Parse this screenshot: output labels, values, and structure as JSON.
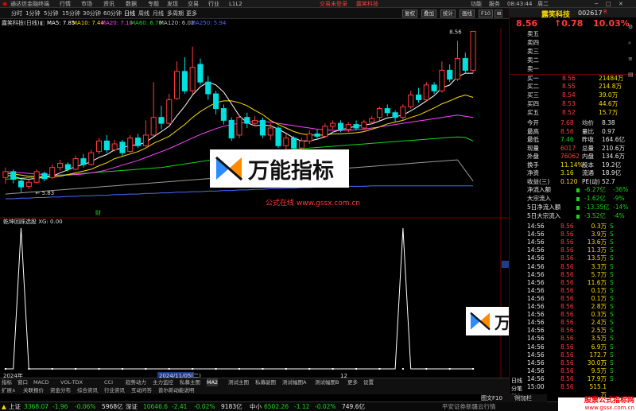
{
  "menu": {
    "app": "通达信金融终端",
    "items": [
      "行情",
      "市场",
      "资讯",
      "数据",
      "专题",
      "发现",
      "交易",
      "行业",
      "L1L2"
    ],
    "center_login": "交易未登录",
    "center_stock": "露笑科技",
    "right": [
      "功能",
      "服务",
      "08:43:44",
      "周二"
    ]
  },
  "timeframes": [
    "分时",
    "1分钟",
    "5分钟",
    "15分钟",
    "30分钟",
    "60分钟",
    "日线",
    "周线",
    "月线",
    "多周期",
    "更多"
  ],
  "toolbar_buttons": [
    "复权",
    "叠加",
    "统计",
    "画线",
    "F10"
  ],
  "title_bar": {
    "name": "露笑科技(日线)",
    "indicators": [
      {
        "label": "MA5: 7.85",
        "color": "#ffffff"
      },
      {
        "label": "MA10: 7.44",
        "color": "#ffdd00"
      },
      {
        "label": "MA20: 7.10",
        "color": "#ff44ff"
      },
      {
        "label": "MA60: 6.70",
        "color": "#19d619"
      },
      {
        "label": "MA120: 6.02",
        "color": "#c0c0c0"
      },
      {
        "label": "MA250: 5.94",
        "color": "#4a6cff"
      }
    ]
  },
  "chart_data": {
    "type": "candlestick",
    "y_ticks": [
      "8.50",
      "8.25",
      "8.00",
      "7.75",
      "7.50",
      "7.25",
      "7.00",
      "6.75",
      "6.50",
      "6.25",
      "6.00",
      "5.75"
    ],
    "high_label": "8.56",
    "low_label": "5.83",
    "candles": [
      {
        "o": 6.08,
        "c": 6.18,
        "h": 6.25,
        "l": 5.97
      },
      {
        "o": 6.18,
        "c": 6.05,
        "h": 6.22,
        "l": 5.98
      },
      {
        "o": 6.02,
        "c": 5.92,
        "h": 6.06,
        "l": 5.83
      },
      {
        "o": 5.93,
        "c": 6.0,
        "h": 6.05,
        "l": 5.88
      },
      {
        "o": 6.0,
        "c": 6.18,
        "h": 6.22,
        "l": 5.97
      },
      {
        "o": 6.15,
        "c": 6.06,
        "h": 6.18,
        "l": 6.02
      },
      {
        "o": 6.08,
        "c": 6.25,
        "h": 6.3,
        "l": 6.05
      },
      {
        "o": 6.25,
        "c": 6.32,
        "h": 6.38,
        "l": 6.2
      },
      {
        "o": 6.3,
        "c": 6.22,
        "h": 6.34,
        "l": 6.18
      },
      {
        "o": 6.22,
        "c": 6.4,
        "h": 6.45,
        "l": 6.2
      },
      {
        "o": 6.4,
        "c": 6.3,
        "h": 6.48,
        "l": 6.25
      },
      {
        "o": 6.3,
        "c": 6.5,
        "h": 6.55,
        "l": 6.28
      },
      {
        "o": 6.52,
        "c": 6.7,
        "h": 6.75,
        "l": 6.48
      },
      {
        "o": 6.7,
        "c": 6.55,
        "h": 6.8,
        "l": 6.5
      },
      {
        "o": 6.55,
        "c": 6.65,
        "h": 6.72,
        "l": 6.52
      },
      {
        "o": 6.68,
        "c": 6.5,
        "h": 6.72,
        "l": 6.45
      },
      {
        "o": 6.52,
        "c": 6.75,
        "h": 6.8,
        "l": 6.5
      },
      {
        "o": 6.75,
        "c": 6.62,
        "h": 6.82,
        "l": 6.58
      },
      {
        "o": 6.62,
        "c": 6.8,
        "h": 7.05,
        "l": 6.6
      },
      {
        "o": 6.8,
        "c": 7.1,
        "h": 7.7,
        "l": 6.78
      },
      {
        "o": 7.1,
        "c": 7.0,
        "h": 7.3,
        "l": 6.9
      },
      {
        "o": 7.0,
        "c": 7.4,
        "h": 7.5,
        "l": 6.98
      },
      {
        "o": 7.42,
        "c": 7.88,
        "h": 8.05,
        "l": 7.4
      },
      {
        "o": 7.88,
        "c": 7.55,
        "h": 8.12,
        "l": 7.5
      },
      {
        "o": 7.55,
        "c": 7.95,
        "h": 8.3,
        "l": 7.5
      },
      {
        "o": 8.0,
        "c": 7.7,
        "h": 8.1,
        "l": 7.65
      },
      {
        "o": 7.7,
        "c": 7.5,
        "h": 7.8,
        "l": 7.4
      },
      {
        "o": 7.5,
        "c": 7.25,
        "h": 7.55,
        "l": 7.15
      },
      {
        "o": 7.25,
        "c": 7.05,
        "h": 7.32,
        "l": 6.98
      },
      {
        "o": 7.05,
        "c": 6.75,
        "h": 7.1,
        "l": 6.7
      },
      {
        "o": 6.8,
        "c": 7.1,
        "h": 7.15,
        "l": 6.75
      },
      {
        "o": 7.1,
        "c": 7.0,
        "h": 7.18,
        "l": 6.92
      },
      {
        "o": 7.0,
        "c": 7.05,
        "h": 7.12,
        "l": 6.95
      },
      {
        "o": 7.05,
        "c": 6.8,
        "h": 7.1,
        "l": 6.75
      },
      {
        "o": 6.8,
        "c": 6.92,
        "h": 7.0,
        "l": 6.72
      },
      {
        "o": 6.92,
        "c": 6.62,
        "h": 6.95,
        "l": 6.58
      },
      {
        "o": 6.62,
        "c": 6.75,
        "h": 6.82,
        "l": 6.55
      },
      {
        "o": 6.75,
        "c": 6.58,
        "h": 6.78,
        "l": 6.5
      },
      {
        "o": 6.58,
        "c": 6.7,
        "h": 6.75,
        "l": 6.52
      },
      {
        "o": 6.7,
        "c": 6.82,
        "h": 6.88,
        "l": 6.65
      },
      {
        "o": 6.82,
        "c": 6.78,
        "h": 6.9,
        "l": 6.72
      },
      {
        "o": 6.78,
        "c": 6.95,
        "h": 7.0,
        "l": 6.75
      },
      {
        "o": 6.95,
        "c": 7.0,
        "h": 7.05,
        "l": 6.9
      },
      {
        "o": 7.0,
        "c": 6.9,
        "h": 7.05,
        "l": 6.85
      },
      {
        "o": 6.9,
        "c": 6.98,
        "h": 7.02,
        "l": 6.85
      },
      {
        "o": 6.98,
        "c": 6.92,
        "h": 7.05,
        "l": 6.88
      },
      {
        "o": 6.92,
        "c": 7.02,
        "h": 7.06,
        "l": 6.88
      },
      {
        "o": 7.02,
        "c": 7.08,
        "h": 7.12,
        "l": 6.98
      },
      {
        "o": 7.1,
        "c": 7.25,
        "h": 7.28,
        "l": 7.05
      },
      {
        "o": 7.25,
        "c": 7.18,
        "h": 7.32,
        "l": 7.12
      },
      {
        "o": 7.18,
        "c": 7.1,
        "h": 7.22,
        "l": 7.02
      },
      {
        "o": 7.1,
        "c": 7.28,
        "h": 7.32,
        "l": 7.05
      },
      {
        "o": 7.28,
        "c": 7.48,
        "h": 7.55,
        "l": 7.25
      },
      {
        "o": 7.48,
        "c": 7.4,
        "h": 7.6,
        "l": 7.35
      },
      {
        "o": 7.4,
        "c": 7.65,
        "h": 7.7,
        "l": 7.38
      },
      {
        "o": 7.65,
        "c": 7.55,
        "h": 7.7,
        "l": 7.5
      },
      {
        "o": 7.55,
        "c": 7.9,
        "h": 8.05,
        "l": 7.52
      },
      {
        "o": 7.9,
        "c": 7.75,
        "h": 8.0,
        "l": 7.7
      },
      {
        "o": 7.75,
        "c": 8.1,
        "h": 8.4,
        "l": 7.72
      },
      {
        "o": 8.1,
        "c": 7.9,
        "h": 8.2,
        "l": 7.85
      },
      {
        "o": 7.9,
        "c": 8.56,
        "h": 8.56,
        "l": 7.85
      }
    ],
    "ma5": [
      6.12,
      6.1,
      6.06,
      6.05,
      6.07,
      6.08,
      6.1,
      6.16,
      6.21,
      6.27,
      6.3,
      6.35,
      6.42,
      6.47,
      6.55,
      6.58,
      6.63,
      6.63,
      6.68,
      6.77,
      6.86,
      6.95,
      7.13,
      7.29,
      7.48,
      7.62,
      7.7,
      7.65,
      7.53,
      7.33,
      7.13,
      7.01,
      6.96,
      6.97,
      6.96,
      6.9,
      6.83,
      6.75,
      6.7,
      6.7,
      6.73,
      6.77,
      6.85,
      6.89,
      6.92,
      6.95,
      6.97,
      6.99,
      7.04,
      7.09,
      7.11,
      7.14,
      7.21,
      7.29,
      7.38,
      7.47,
      7.6,
      7.65,
      7.79,
      7.85,
      7.85
    ],
    "ma10": [
      6.15,
      6.14,
      6.12,
      6.1,
      6.1,
      6.09,
      6.09,
      6.1,
      6.13,
      6.16,
      6.19,
      6.22,
      6.28,
      6.33,
      6.4,
      6.44,
      6.48,
      6.52,
      6.58,
      6.66,
      6.72,
      6.78,
      6.88,
      6.98,
      7.1,
      7.2,
      7.28,
      7.35,
      7.38,
      7.38,
      7.35,
      7.3,
      7.22,
      7.15,
      7.05,
      6.98,
      6.92,
      6.86,
      6.82,
      6.8,
      6.8,
      6.8,
      6.82,
      6.82,
      6.83,
      6.84,
      6.86,
      6.9,
      6.94,
      6.99,
      7.02,
      7.05,
      7.1,
      7.14,
      7.2,
      7.26,
      7.33,
      7.38,
      7.44,
      7.48,
      7.44
    ],
    "ma20": [
      6.18,
      6.17,
      6.16,
      6.15,
      6.14,
      6.13,
      6.12,
      6.12,
      6.12,
      6.13,
      6.14,
      6.16,
      6.18,
      6.21,
      6.25,
      6.29,
      6.33,
      6.37,
      6.42,
      6.47,
      6.52,
      6.57,
      6.63,
      6.69,
      6.75,
      6.81,
      6.86,
      6.91,
      6.95,
      6.98,
      7.0,
      7.02,
      7.03,
      7.03,
      7.02,
      7.0,
      6.98,
      6.96,
      6.94,
      6.92,
      6.9,
      6.89,
      6.88,
      6.88,
      6.88,
      6.89,
      6.9,
      6.92,
      6.94,
      6.96,
      6.98,
      7.0,
      7.02,
      7.04,
      7.06,
      7.08,
      7.1,
      7.12,
      7.14,
      7.12,
      7.1
    ],
    "ma60": [
      6.05,
      6.06,
      6.07,
      6.08,
      6.09,
      6.1,
      6.11,
      6.12,
      6.13,
      6.14,
      6.15,
      6.16,
      6.17,
      6.18,
      6.19,
      6.2,
      6.21,
      6.22,
      6.23,
      6.24,
      6.25,
      6.27,
      6.29,
      6.31,
      6.33,
      6.35,
      6.37,
      6.39,
      6.41,
      6.43,
      6.45,
      6.47,
      6.49,
      6.51,
      6.53,
      6.54,
      6.55,
      6.56,
      6.57,
      6.58,
      6.59,
      6.6,
      6.61,
      6.62,
      6.63,
      6.64,
      6.65,
      6.66,
      6.67,
      6.68,
      6.69,
      6.7,
      6.71,
      6.72,
      6.73,
      6.74,
      6.75,
      6.76,
      6.77,
      6.76,
      6.7
    ],
    "ma120": [
      5.8,
      5.81,
      5.82,
      5.83,
      5.84,
      5.85,
      5.86,
      5.87,
      5.88,
      5.89,
      5.9,
      5.91,
      5.92,
      5.93,
      5.94,
      5.95,
      5.96,
      5.97,
      5.98,
      5.99,
      6.0,
      6.01,
      6.02,
      6.03,
      6.04,
      6.05,
      6.06,
      6.07,
      6.08,
      6.09,
      6.1,
      6.11,
      6.12,
      6.13,
      6.14,
      6.15,
      6.16,
      6.17,
      6.18,
      6.19,
      6.2,
      6.21,
      6.22,
      6.23,
      6.24,
      6.25,
      6.26,
      6.27,
      6.28,
      6.29,
      6.3,
      6.31,
      6.32,
      6.33,
      6.34,
      6.35,
      6.36,
      6.37,
      6.38,
      6.2,
      6.02
    ],
    "ma250": [
      5.72,
      5.72,
      5.73,
      5.73,
      5.74,
      5.74,
      5.75,
      5.75,
      5.76,
      5.76,
      5.77,
      5.77,
      5.78,
      5.78,
      5.79,
      5.79,
      5.8,
      5.8,
      5.81,
      5.81,
      5.82,
      5.82,
      5.83,
      5.83,
      5.84,
      5.84,
      5.85,
      5.85,
      5.86,
      5.86,
      5.87,
      5.87,
      5.88,
      5.88,
      5.89,
      5.89,
      5.9,
      5.9,
      5.91,
      5.91,
      5.92,
      5.92,
      5.92,
      5.93,
      5.93,
      5.93,
      5.93,
      5.94,
      5.94,
      5.94,
      5.94,
      5.94,
      5.94,
      5.94,
      5.94,
      5.94,
      5.94,
      5.94,
      5.94,
      5.94,
      5.94
    ],
    "marker_label": "财",
    "watermark_url": "公式在线  www.gssx.com.cn",
    "indicator_panel": {
      "title": "乾坤回踩选股  XG: 0.00",
      "right_labels": [
        "1.00",
        "0.76",
        "0.50",
        "0.20",
        "0.00"
      ],
      "spikes_at": [
        2,
        51
      ],
      "axis_labels": [
        "2024年",
        "2024/11/05(二)",
        "12"
      ]
    }
  },
  "stock": {
    "name": "露笑科技",
    "code": "002617",
    "price": "8.56",
    "change": "↑0.78",
    "pct": "10.03%",
    "order_book": [
      {
        "label": "卖五",
        "price": "",
        "vol": ""
      },
      {
        "label": "卖四",
        "price": "",
        "vol": ""
      },
      {
        "label": "卖三",
        "price": "",
        "vol": ""
      },
      {
        "label": "卖二",
        "price": "",
        "vol": ""
      },
      {
        "label": "卖一",
        "price": "",
        "vol": ""
      },
      {
        "label": "买一",
        "price": "8.56",
        "vol": "21484万"
      },
      {
        "label": "买二",
        "price": "8.55",
        "vol": "214.8万"
      },
      {
        "label": "买三",
        "price": "8.54",
        "vol": "39.0万"
      },
      {
        "label": "买四",
        "price": "8.53",
        "vol": "44.6万"
      },
      {
        "label": "买五",
        "price": "8.52",
        "vol": "15.7万"
      }
    ],
    "stats": [
      {
        "l1": "今开",
        "v1": "7.68",
        "l2": "均价",
        "v2": "8.38"
      },
      {
        "l1": "最高",
        "v1": "8.56",
        "l2": "量比",
        "v2": "0.97"
      },
      {
        "l1": "最低",
        "v1": "7.46",
        "l2": "昨收",
        "v2": "164.6亿"
      },
      {
        "l1": "现量",
        "v1": "6017",
        "l2": "总量",
        "v2": "210.6万"
      },
      {
        "l1": "外盘",
        "v1": "76062",
        "l2": "内盘",
        "v2": "134.6万"
      },
      {
        "l1": "换手",
        "v1": "11.14%",
        "l2": "股本",
        "v2": "19.2亿"
      },
      {
        "l1": "净资",
        "v1": "3.16",
        "l2": "流通",
        "v2": "18.9亿"
      },
      {
        "l1": "收益(三)",
        "v1": "0.120",
        "l2": "PE(动)",
        "v2": "52.7"
      }
    ],
    "flows": [
      {
        "label": "净流入额",
        "value": "-6.27亿",
        "pct": "-36%"
      },
      {
        "label": "大宗流入",
        "value": "-1.62亿",
        "pct": "-9%"
      },
      {
        "label": "5日净流入额",
        "value": "-13.35亿",
        "pct": "-14%"
      },
      {
        "label": "5日大宗流入",
        "value": "-3.52亿",
        "pct": "-4%"
      }
    ],
    "ticks": [
      {
        "t": "14:56",
        "p": "8.56",
        "v": "0.3万",
        "d": "S"
      },
      {
        "t": "14:56",
        "p": "8.56",
        "v": "3.9万",
        "d": "S"
      },
      {
        "t": "14:56",
        "p": "8.56",
        "v": "13.6万",
        "d": "S"
      },
      {
        "t": "14:56",
        "p": "8.56",
        "v": "11.3万",
        "d": "S"
      },
      {
        "t": "14:56",
        "p": "8.56",
        "v": "13.5万",
        "d": "S"
      },
      {
        "t": "14:56",
        "p": "8.56",
        "v": "3.3万",
        "d": "S"
      },
      {
        "t": "14:56",
        "p": "8.56",
        "v": "5.7万",
        "d": "S"
      },
      {
        "t": "14:56",
        "p": "8.56",
        "v": "11.6万",
        "d": "S"
      },
      {
        "t": "14:56",
        "p": "8.56",
        "v": "0.1万",
        "d": "S"
      },
      {
        "t": "14:56",
        "p": "8.56",
        "v": "0.1万",
        "d": "S"
      },
      {
        "t": "14:56",
        "p": "8.56",
        "v": "2.8万",
        "d": "S"
      },
      {
        "t": "14:56",
        "p": "8.56",
        "v": "0.3万",
        "d": "S"
      },
      {
        "t": "14:56",
        "p": "8.56",
        "v": "2.4万",
        "d": "S"
      },
      {
        "t": "14:56",
        "p": "8.56",
        "v": "2.5万",
        "d": "S"
      },
      {
        "t": "14:56",
        "p": "8.56",
        "v": "3.5万",
        "d": "S"
      },
      {
        "t": "14:56",
        "p": "8.56",
        "v": "6.9万",
        "d": "S"
      },
      {
        "t": "14:56",
        "p": "8.56",
        "v": "172.7万",
        "d": "S"
      },
      {
        "t": "14:56",
        "p": "8.56",
        "v": "30.0万",
        "d": "S"
      },
      {
        "t": "14:56",
        "p": "8.56",
        "v": "9.5万",
        "d": "S"
      },
      {
        "t": "14:56",
        "p": "8.56",
        "v": "17.9万",
        "d": "S"
      },
      {
        "t": "15:00",
        "p": "8.56",
        "v": "515.1万",
        "d": ""
      }
    ],
    "side_labels": [
      "日线",
      "分笔",
      "财务"
    ]
  },
  "bottom_tabs": [
    "指标",
    "窗口",
    "MACD",
    "VOL-TDX",
    "CCI",
    "趋势动力",
    "主力监控",
    "私募主图",
    "MA2",
    "测试主图",
    "私募副图",
    "测试幅图A",
    "测试幅图B",
    "更多",
    "设置"
  ],
  "bottom_tabs2": [
    "扩展∧",
    "关联报价",
    "资金分布",
    "综合资讯",
    "行业资讯",
    "互动问答",
    "普尔新动能说明"
  ],
  "status": {
    "sh_label": "上证",
    "sh_val": "3368.07",
    "sh_chg": "-1.96",
    "sh_pct": "-0.06%",
    "sh_amt": "5968亿",
    "sz_label": "深证",
    "sz_val": "10646.6",
    "sz_chg": "-2.41",
    "sz_pct": "-0.02%",
    "sz_amt": "9183亿",
    "zx_label": "中小",
    "zx_val": "6502.26",
    "zx_chg": "-1.12",
    "zx_pct": "-0.02%",
    "zx_amt": "749.6亿",
    "right_text": "平安证券新疆云行情",
    "right_panel_tabs": [
      "图文F10",
      "附加栏"
    ]
  },
  "watermarks": {
    "logo_text": "万能指标",
    "site_text": "股票公式指标网",
    "site_url": "www.gssx.com.cn"
  }
}
